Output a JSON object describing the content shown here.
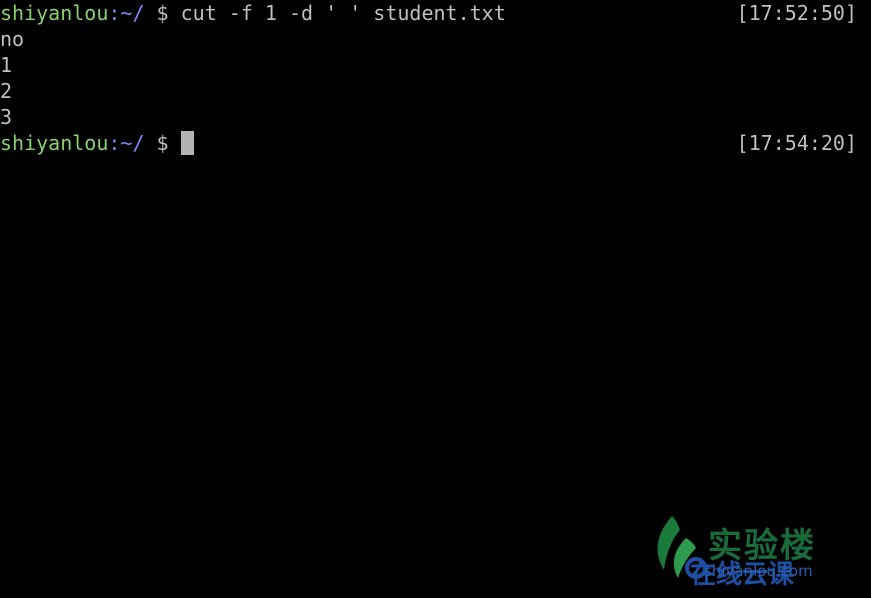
{
  "terminal": {
    "line1": {
      "user": "shiyanlou",
      "path": ":~/",
      "dollar": " $ ",
      "command": "cut -f 1 -d ' ' student.txt",
      "timestamp": "[17:52:50]"
    },
    "output": [
      "no",
      "1",
      "2",
      "3"
    ],
    "line6": {
      "user": "shiyanlou",
      "path": ":~/",
      "dollar": " $ ",
      "timestamp": "[17:54:20]"
    }
  },
  "watermark": {
    "title": "实验楼",
    "subtitle": "在线云课",
    "domain": "shiyanlou.com",
    "logo_icon": "leaf-logo-icon"
  },
  "colors": {
    "background": "#000000",
    "user": "#86d16e",
    "path": "#7a8cf0",
    "text": "#bfbfbf",
    "cursor": "#b3b3b3"
  }
}
